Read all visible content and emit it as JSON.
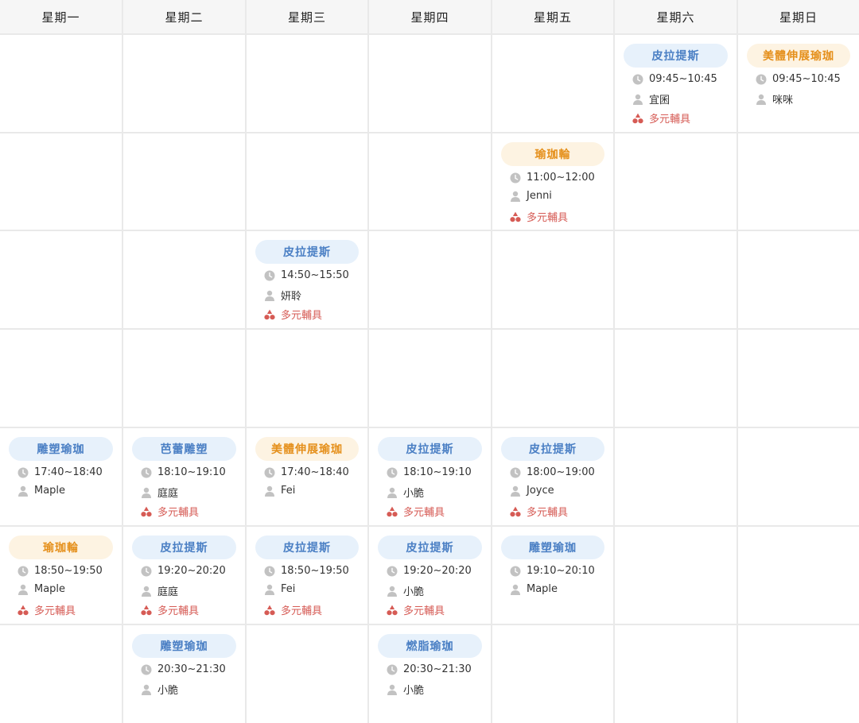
{
  "days": [
    "星期一",
    "星期二",
    "星期三",
    "星期四",
    "星期五",
    "星期六",
    "星期日"
  ],
  "row_count": 7,
  "colors": {
    "blue_pill_bg": "#e7f1fb",
    "blue_pill_text": "#4a7fc4",
    "orange_pill_bg": "#fdf3e2",
    "orange_pill_text": "#e5901c",
    "equipment_text": "#d65b55",
    "icon_gray": "#c2c2c2"
  },
  "icons": {
    "time": "clock-icon",
    "teacher": "person-icon",
    "equipment": "shapes-icon"
  },
  "classes": [
    {
      "day": 5,
      "slot": 0,
      "name": "皮拉提斯",
      "color": "blue",
      "time": "09:45~10:45",
      "teacher": "宜囷",
      "equipment": "多元輔具"
    },
    {
      "day": 6,
      "slot": 0,
      "name": "美體伸展瑜珈",
      "color": "orange",
      "time": "09:45~10:45",
      "teacher": "咪咪",
      "equipment": ""
    },
    {
      "day": 4,
      "slot": 1,
      "name": "瑜珈輪",
      "color": "orange",
      "time": "11:00~12:00",
      "teacher": "Jenni",
      "equipment": "多元輔具"
    },
    {
      "day": 2,
      "slot": 2,
      "name": "皮拉提斯",
      "color": "blue",
      "time": "14:50~15:50",
      "teacher": "妍聆",
      "equipment": "多元輔具"
    },
    {
      "day": 0,
      "slot": 4,
      "name": "雕塑瑜珈",
      "color": "blue",
      "time": "17:40~18:40",
      "teacher": "Maple",
      "equipment": ""
    },
    {
      "day": 1,
      "slot": 4,
      "name": "芭蕾雕塑",
      "color": "blue",
      "time": "18:10~19:10",
      "teacher": "庭庭",
      "equipment": "多元輔具"
    },
    {
      "day": 2,
      "slot": 4,
      "name": "美體伸展瑜珈",
      "color": "orange",
      "time": "17:40~18:40",
      "teacher": "Fei",
      "equipment": ""
    },
    {
      "day": 3,
      "slot": 4,
      "name": "皮拉提斯",
      "color": "blue",
      "time": "18:10~19:10",
      "teacher": "小脆",
      "equipment": "多元輔具"
    },
    {
      "day": 4,
      "slot": 4,
      "name": "皮拉提斯",
      "color": "blue",
      "time": "18:00~19:00",
      "teacher": "Joyce",
      "equipment": "多元輔具"
    },
    {
      "day": 0,
      "slot": 5,
      "name": "瑜珈輪",
      "color": "orange",
      "time": "18:50~19:50",
      "teacher": "Maple",
      "equipment": "多元輔具"
    },
    {
      "day": 1,
      "slot": 5,
      "name": "皮拉提斯",
      "color": "blue",
      "time": "19:20~20:20",
      "teacher": "庭庭",
      "equipment": "多元輔具"
    },
    {
      "day": 2,
      "slot": 5,
      "name": "皮拉提斯",
      "color": "blue",
      "time": "18:50~19:50",
      "teacher": "Fei",
      "equipment": "多元輔具"
    },
    {
      "day": 3,
      "slot": 5,
      "name": "皮拉提斯",
      "color": "blue",
      "time": "19:20~20:20",
      "teacher": "小脆",
      "equipment": "多元輔具"
    },
    {
      "day": 4,
      "slot": 5,
      "name": "雕塑瑜珈",
      "color": "blue",
      "time": "19:10~20:10",
      "teacher": "Maple",
      "equipment": ""
    },
    {
      "day": 1,
      "slot": 6,
      "name": "雕塑瑜珈",
      "color": "blue",
      "time": "20:30~21:30",
      "teacher": "小脆",
      "equipment": ""
    },
    {
      "day": 3,
      "slot": 6,
      "name": "燃脂瑜珈",
      "color": "blue",
      "time": "20:30~21:30",
      "teacher": "小脆",
      "equipment": ""
    }
  ]
}
